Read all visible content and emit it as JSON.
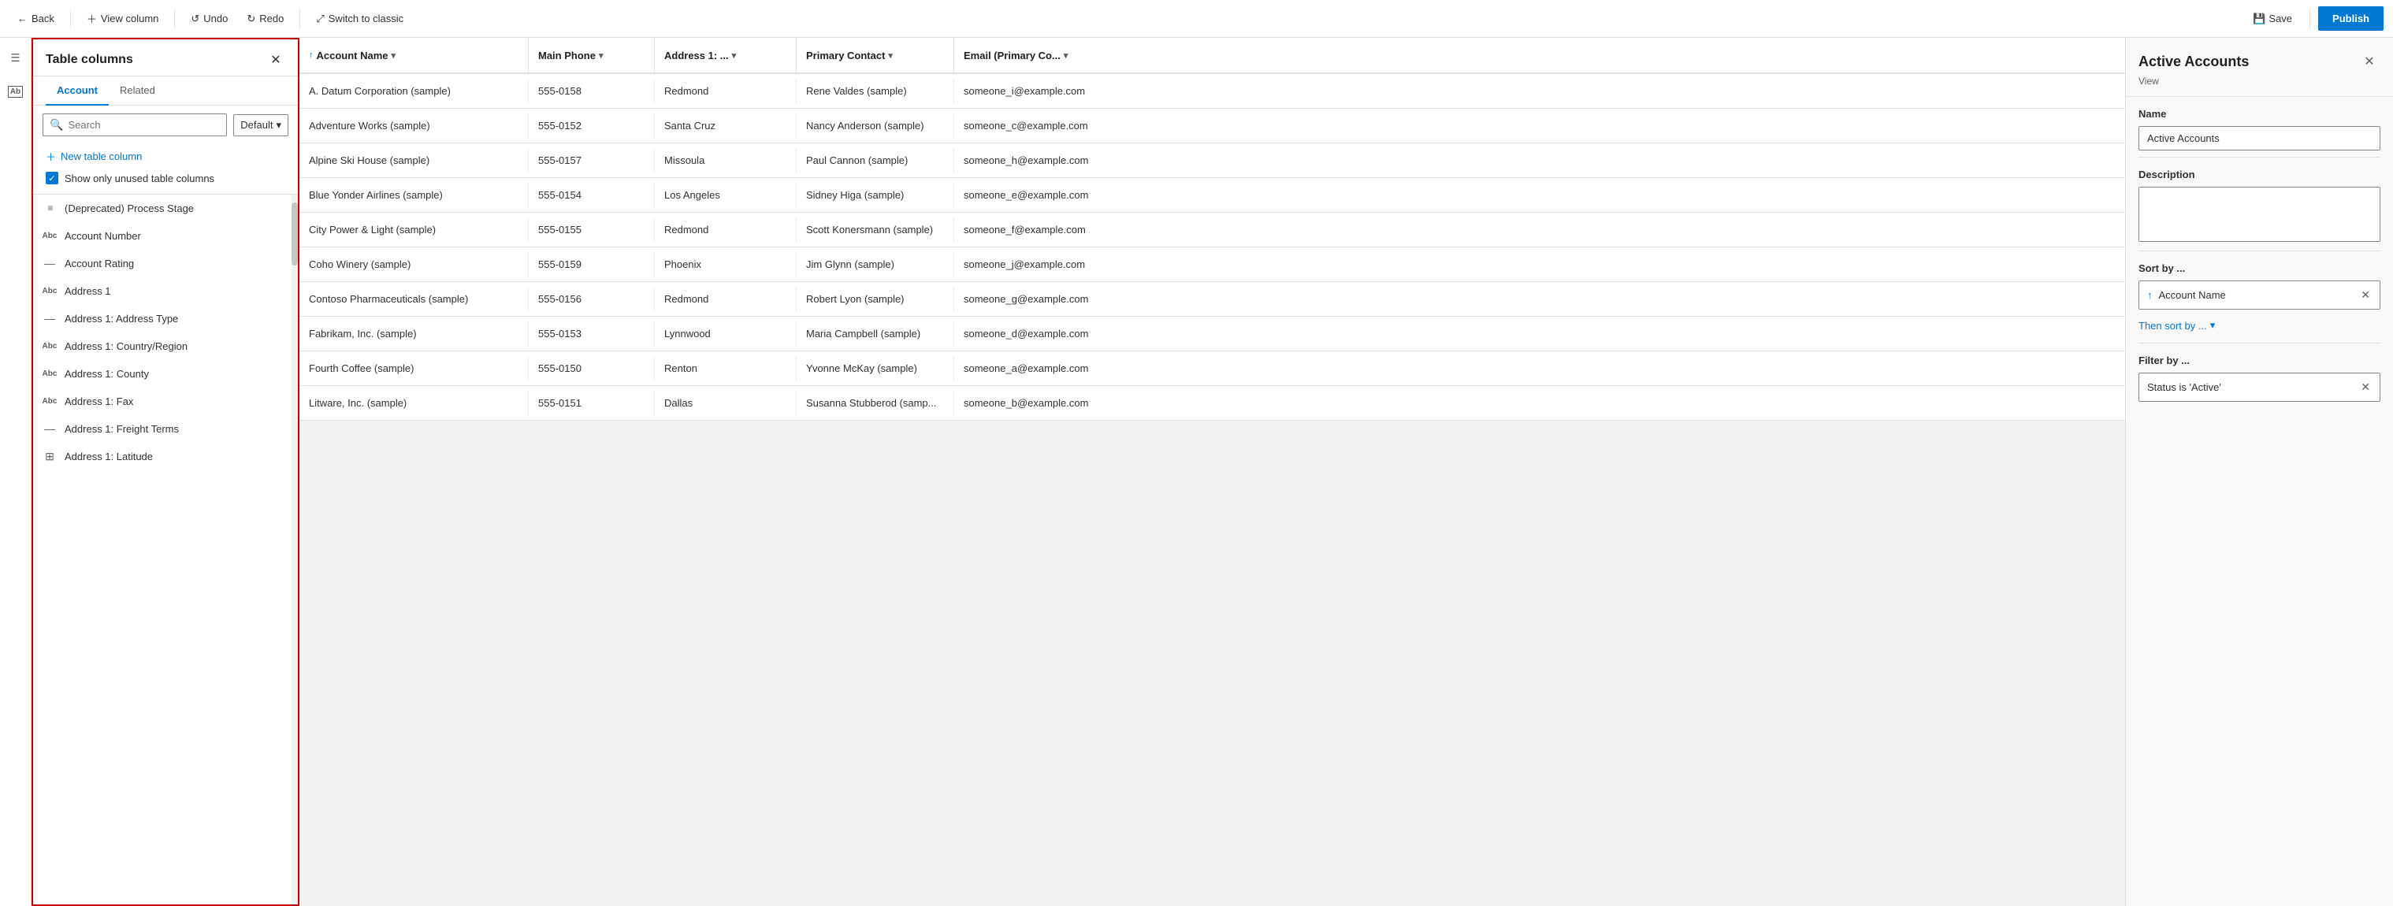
{
  "toolbar": {
    "back_label": "Back",
    "view_column_label": "View column",
    "undo_label": "Undo",
    "redo_label": "Redo",
    "switch_classic_label": "Switch to classic",
    "save_label": "Save",
    "publish_label": "Publish"
  },
  "columns_panel": {
    "title": "Table columns",
    "close_icon": "✕",
    "tab_account": "Account",
    "tab_related": "Related",
    "search_placeholder": "Search",
    "default_dropdown": "Default",
    "new_column_label": "New table column",
    "show_unused_label": "Show only unused table columns",
    "columns": [
      {
        "icon": "≡≡",
        "label": "(Deprecated) Process Stage"
      },
      {
        "icon": "Abc",
        "label": "Account Number"
      },
      {
        "icon": "—",
        "label": "Account Rating"
      },
      {
        "icon": "Abc",
        "label": "Address 1"
      },
      {
        "icon": "—",
        "label": "Address 1: Address Type"
      },
      {
        "icon": "Abc",
        "label": "Address 1: Country/Region"
      },
      {
        "icon": "Abc",
        "label": "Address 1: County"
      },
      {
        "icon": "Abc",
        "label": "Address 1: Fax"
      },
      {
        "icon": "—",
        "label": "Address 1: Freight Terms"
      },
      {
        "icon": "⊞",
        "label": "Address 1: Latitude"
      }
    ]
  },
  "grid": {
    "columns": [
      {
        "label": "Account Name",
        "sortable": true,
        "sorted": true
      },
      {
        "label": "Main Phone",
        "sortable": true,
        "sorted": false
      },
      {
        "label": "Address 1: ...",
        "sortable": true,
        "sorted": false
      },
      {
        "label": "Primary Contact",
        "sortable": true,
        "sorted": false
      },
      {
        "label": "Email (Primary Co...",
        "sortable": true,
        "sorted": false
      }
    ],
    "rows": [
      {
        "account": "A. Datum Corporation (sample)",
        "phone": "555-0158",
        "address": "Redmond",
        "contact": "Rene Valdes (sample)",
        "email": "someone_i@example.com"
      },
      {
        "account": "Adventure Works (sample)",
        "phone": "555-0152",
        "address": "Santa Cruz",
        "contact": "Nancy Anderson (sample)",
        "email": "someone_c@example.com"
      },
      {
        "account": "Alpine Ski House (sample)",
        "phone": "555-0157",
        "address": "Missoula",
        "contact": "Paul Cannon (sample)",
        "email": "someone_h@example.com"
      },
      {
        "account": "Blue Yonder Airlines (sample)",
        "phone": "555-0154",
        "address": "Los Angeles",
        "contact": "Sidney Higa (sample)",
        "email": "someone_e@example.com"
      },
      {
        "account": "City Power & Light (sample)",
        "phone": "555-0155",
        "address": "Redmond",
        "contact": "Scott Konersmann (sample)",
        "email": "someone_f@example.com"
      },
      {
        "account": "Coho Winery (sample)",
        "phone": "555-0159",
        "address": "Phoenix",
        "contact": "Jim Glynn (sample)",
        "email": "someone_j@example.com"
      },
      {
        "account": "Contoso Pharmaceuticals (sample)",
        "phone": "555-0156",
        "address": "Redmond",
        "contact": "Robert Lyon (sample)",
        "email": "someone_g@example.com"
      },
      {
        "account": "Fabrikam, Inc. (sample)",
        "phone": "555-0153",
        "address": "Lynnwood",
        "contact": "Maria Campbell (sample)",
        "email": "someone_d@example.com"
      },
      {
        "account": "Fourth Coffee (sample)",
        "phone": "555-0150",
        "address": "Renton",
        "contact": "Yvonne McKay (sample)",
        "email": "someone_a@example.com"
      },
      {
        "account": "Litware, Inc. (sample)",
        "phone": "555-0151",
        "address": "Dallas",
        "contact": "Susanna Stubberod (samp...",
        "email": "someone_b@example.com"
      }
    ]
  },
  "right_panel": {
    "title": "Active Accounts",
    "subtitle": "View",
    "close_icon": "✕",
    "name_label": "Name",
    "name_value": "Active Accounts",
    "description_label": "Description",
    "description_placeholder": "",
    "sort_label": "Sort by ...",
    "sort_item": "Account Name",
    "sort_icon": "↑",
    "then_sort_label": "Then sort by ...",
    "then_sort_chevron": "▾",
    "filter_label": "Filter by ...",
    "filter_item": "Status is 'Active'",
    "remove_icon": "✕"
  }
}
